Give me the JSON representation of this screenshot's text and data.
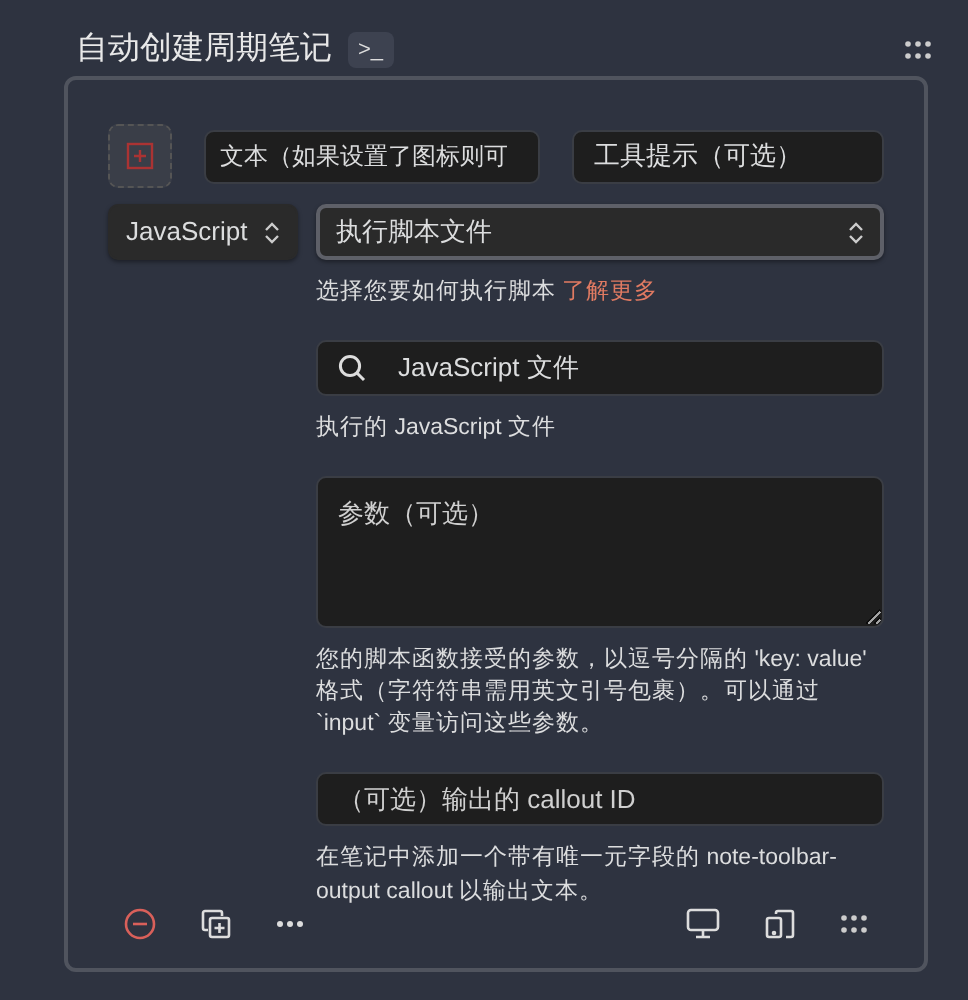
{
  "header": {
    "title": "自动创建周期笔记",
    "badge": ">_"
  },
  "item": {
    "text_field": {
      "value": "文本（如果设置了图标则可"
    },
    "tooltip_field": {
      "value": "工具提示（可选）"
    },
    "language_select": {
      "value": "JavaScript"
    },
    "action_select": {
      "value": "执行脚本文件",
      "focused": true
    },
    "action_help": {
      "text": "选择您要如何执行脚本",
      "link": "了解更多"
    },
    "file_search": {
      "value": "JavaScript 文件"
    },
    "file_help": "执行的 JavaScript 文件",
    "args_field": {
      "placeholder": "参数（可选）"
    },
    "args_help": "您的脚本函数接受的参数，以逗号分隔的 'key: value' 格式（字符符串需用英文引号包裹）。可以通过 `input` 变量访问这些参数。",
    "callout_field": {
      "placeholder": "（可选）输出的 callout ID"
    },
    "callout_help": "在笔记中添加一个带有唯一元字段的 note-toolbar-output callout 以输出文本。"
  }
}
